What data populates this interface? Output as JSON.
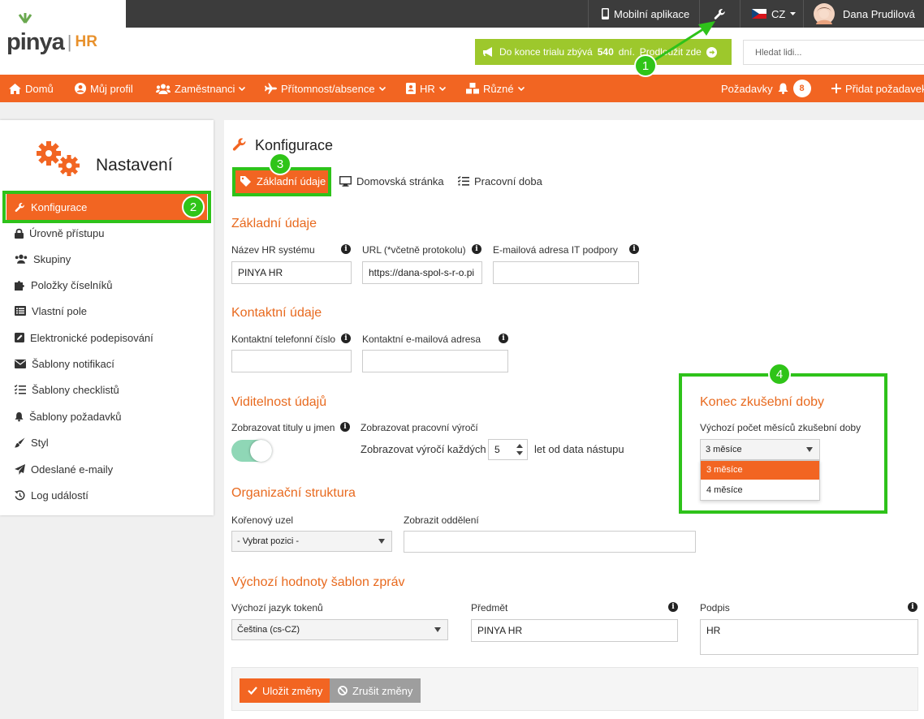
{
  "brand": {
    "wordmark": "pinya",
    "separator": "|",
    "product": "HR",
    "accent": "#f26522",
    "trial_green": "#9dc82c",
    "annotation_green": "#2ec21a"
  },
  "topbar": {
    "mobile_app": "Mobilní aplikace",
    "lang": "CZ",
    "user_name": "Dana Prudilová"
  },
  "trial": {
    "prefix": "Do konce trialu zbývá",
    "days": "540",
    "unit": "dní.",
    "link": "Prodloužit zde"
  },
  "search": {
    "placeholder": "Hledat lidi..."
  },
  "nav": {
    "home": "Domů",
    "profile": "Můj profil",
    "employees": "Zaměstnanci",
    "attendance": "Přítomnost/absence",
    "hr": "HR",
    "misc": "Různé",
    "requests": "Požadavky",
    "requests_count": "8",
    "add_request": "Přidat požadavek"
  },
  "sidebar": {
    "title": "Nastavení",
    "items": [
      "Konfigurace",
      "Úrovně přístupu",
      "Skupiny",
      "Položky číselníků",
      "Vlastní pole",
      "Elektronické podepisování",
      "Šablony notifikací",
      "Šablony checklistů",
      "Šablony požadavků",
      "Styl",
      "Odeslané e-maily",
      "Log událostí"
    ]
  },
  "page": {
    "title": "Konfigurace",
    "tabs": [
      "Základní údaje",
      "Domovská stránka",
      "Pracovní doba"
    ]
  },
  "basic": {
    "heading": "Základní údaje",
    "hr_name_label": "Název HR systému",
    "hr_name_value": "PINYA HR",
    "url_label": "URL (*včetně protokolu)",
    "url_value": "https://dana-spol-s-r-o.pi",
    "it_email_label": "E-mailová adresa IT podpory",
    "it_email_value": ""
  },
  "contact": {
    "heading": "Kontaktní údaje",
    "phone_label": "Kontaktní telefonní číslo",
    "phone_value": "",
    "email_label": "Kontaktní e-mailová adresa",
    "email_value": ""
  },
  "visibility": {
    "heading": "Viditelnost údajů",
    "titles_label": "Zobrazovat tituly u jmen",
    "anniv_label": "Zobrazovat pracovní výročí",
    "anniv_prefix": "Zobrazovat výročí každých",
    "anniv_value": "5",
    "anniv_suffix": "let od data nástupu"
  },
  "probation": {
    "heading": "Konec zkušební doby",
    "label": "Výchozí počet měsíců zkušební doby",
    "selected": "3 měsíce",
    "options": [
      "3 měsíce",
      "4 měsíce"
    ]
  },
  "org": {
    "heading": "Organizační struktura",
    "root_label": "Kořenový uzel",
    "root_value": "- Vybrat pozici -",
    "dept_label": "Zobrazit oddělení",
    "dept_value": ""
  },
  "templates": {
    "heading": "Výchozí hodnoty šablon zpráv",
    "lang_label": "Výchozí jazyk tokenů",
    "lang_value": "Čeština (cs-CZ)",
    "subject_label": "Předmět",
    "subject_value": "PINYA HR",
    "sign_label": "Podpis",
    "sign_value": "HR"
  },
  "actions": {
    "save": "Uložit změny",
    "cancel": "Zrušit změny"
  },
  "annotations": {
    "n1": "1",
    "n2": "2",
    "n3": "3",
    "n4": "4"
  }
}
